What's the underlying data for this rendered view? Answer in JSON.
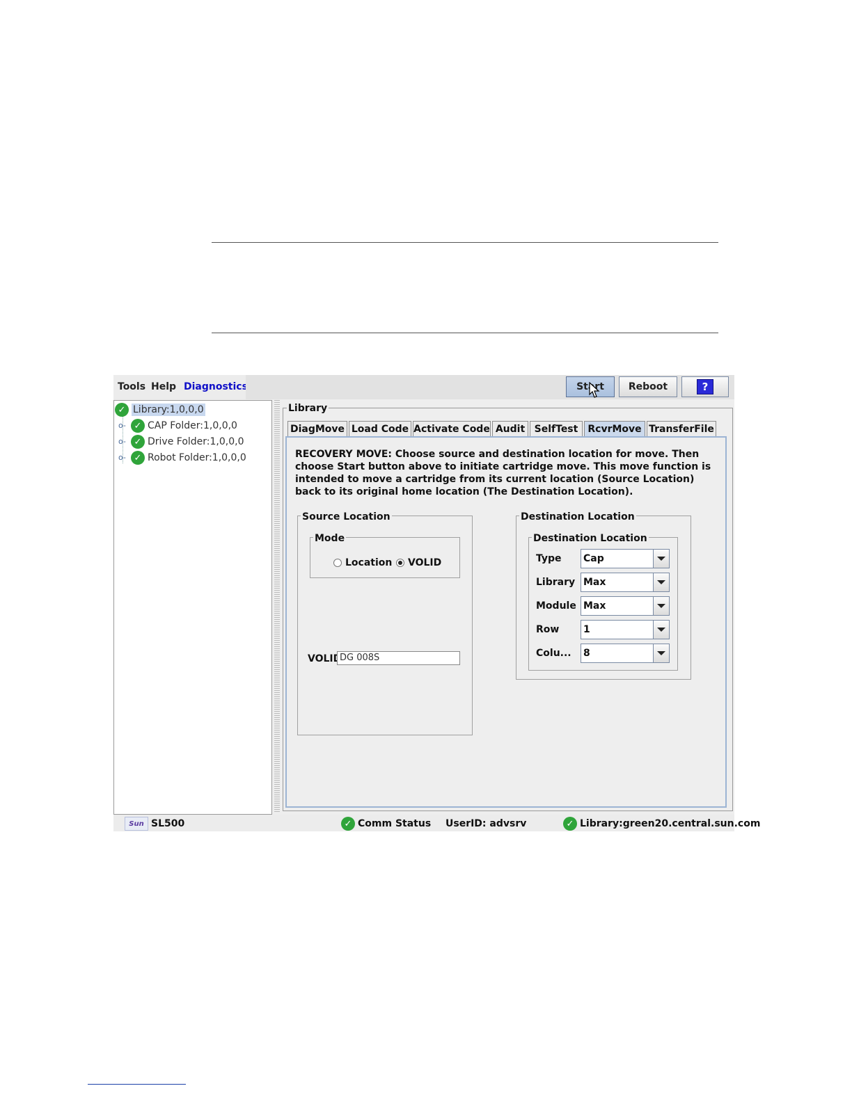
{
  "menu": {
    "tools": "Tools",
    "help": "Help",
    "diagnostics": "Diagnostics"
  },
  "toolbar": {
    "start": "Start",
    "reboot": "Reboot",
    "help_icon": "?"
  },
  "tree": {
    "root": "Library:1,0,0,0",
    "children": [
      "CAP Folder:1,0,0,0",
      "Drive Folder:1,0,0,0",
      "Robot Folder:1,0,0,0"
    ]
  },
  "panel": {
    "title": "Library",
    "tabs": [
      "DiagMove",
      "Load Code",
      "Activate Code",
      "Audit",
      "SelfTest",
      "RcvrMove",
      "TransferFile"
    ],
    "active_tab": "RcvrMove",
    "description": "RECOVERY MOVE: Choose source and destination location for move. Then choose Start button above to initiate cartridge move. This move function is intended to move a cartridge from its current location (Source Location) back to its original home location (The Destination Location).",
    "source": {
      "title": "Source Location",
      "mode_title": "Mode",
      "option_location": "Location",
      "option_volid": "VOLID",
      "selected": "VOLID",
      "volid_label": "VOLID",
      "volid_value": "DG 008S"
    },
    "destination": {
      "title": "Destination Location",
      "inner_title": "Destination Location",
      "fields": [
        {
          "label": "Type",
          "value": "Cap"
        },
        {
          "label": "Library",
          "value": "Max"
        },
        {
          "label": "Module",
          "value": "Max"
        },
        {
          "label": "Row",
          "value": "1"
        },
        {
          "label": "Colu...",
          "value": "8"
        }
      ]
    }
  },
  "status": {
    "product": "SL500",
    "logo_text": "Sun",
    "comm": "Comm Status",
    "user": "UserID: advsrv",
    "library": "Library:green20.central.sun.com"
  },
  "icons": {
    "check": "check-circle-icon",
    "tree_key": "tree-key-icon",
    "combo_arrow": "chevron-down-icon"
  },
  "colors": {
    "accent": "#1010c8",
    "ok": "#2fa43a",
    "active_tab": "#cbd9ec"
  }
}
